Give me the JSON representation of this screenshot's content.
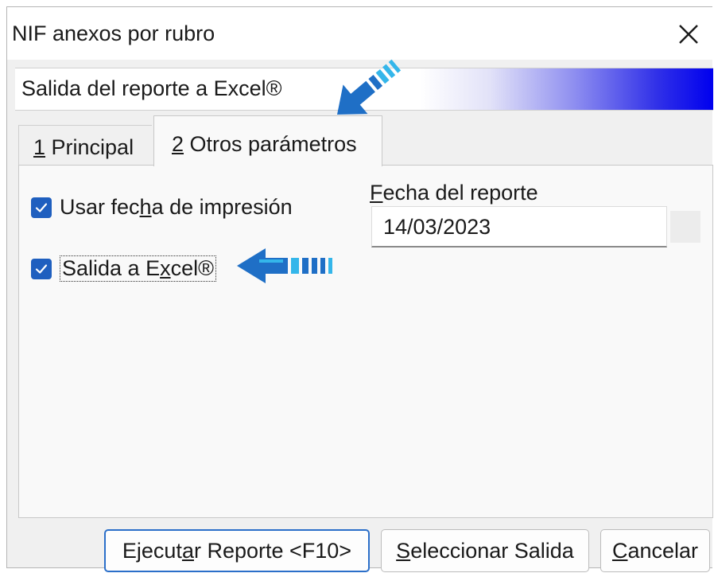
{
  "window": {
    "title": "NIF anexos por rubro",
    "close_icon": "close-icon"
  },
  "banner": {
    "text": "Salida del reporte a Excel®"
  },
  "tabs": [
    {
      "mnemonic": "1",
      "label": " Principal",
      "active": false
    },
    {
      "mnemonic": "2",
      "label": " Otros parámetros",
      "active": true
    }
  ],
  "options": {
    "usar_fecha": {
      "pre": "Usar fec",
      "mn": "h",
      "post": "a de impresión",
      "checked": true
    },
    "salida_excel": {
      "pre": "Salida a E",
      "mn": "x",
      "post": "cel®",
      "checked": true
    }
  },
  "fecha": {
    "label_mn": "F",
    "label_rest": "echa del reporte",
    "value": "14/03/2023"
  },
  "buttons": {
    "ejecutar": {
      "pre": "Ejecut",
      "mn": "a",
      "post": "r Reporte <F10>"
    },
    "seleccionar": {
      "mn": "S",
      "post": "eleccionar Salida"
    },
    "cancelar": {
      "mn": "C",
      "post": "ancelar"
    }
  },
  "colors": {
    "checkbox": "#1f5fbf",
    "arrow_dark": "#1f6fc6",
    "arrow_light": "#34b6ea",
    "banner_gradient_end": "#0000ee"
  }
}
